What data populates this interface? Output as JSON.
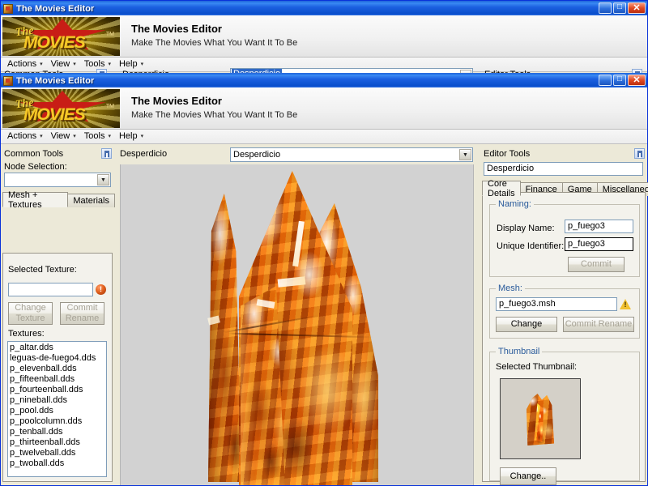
{
  "app": {
    "window_title": "The Movies Editor",
    "banner_title": "The Movies Editor",
    "banner_subtitle": "Make The Movies What You Want It To Be",
    "logo_the": "The",
    "logo_movies": "MOVIES",
    "logo_tm": "TM",
    "accent_title_blue": "#0a4ecb",
    "panel_face": "#ece9d8",
    "viewport_bg": "#d2d2d2"
  },
  "titlebar_buttons": {
    "minimize": "_",
    "maximize": "□",
    "close": "✕"
  },
  "menu": {
    "items": [
      {
        "label": "Actions",
        "arrow": "▾"
      },
      {
        "label": "View",
        "arrow": "▾"
      },
      {
        "label": "Tools",
        "arrow": "▾"
      },
      {
        "label": "Help",
        "arrow": "▾"
      }
    ]
  },
  "background_window": {
    "common_tools_label": "Common Tools",
    "node_label": "Desperdicio",
    "combo_value": "Desperdicio",
    "editor_tools_label": "Editor Tools"
  },
  "left_panel": {
    "header": "Common Tools",
    "node_selection_label": "Node Selection:",
    "node_selection_value": "",
    "tabs": [
      {
        "label": "Mesh + Textures",
        "active": true
      },
      {
        "label": "Materials",
        "active": false
      }
    ],
    "selected_texture_label": "Selected Texture:",
    "selected_texture_value": "",
    "change_texture_button": "Change\nTexture",
    "change_texture_line1": "Change",
    "change_texture_line2": "Texture",
    "commit_rename_line1": "Commit",
    "commit_rename_line2": "Rename",
    "textures_label": "Textures:",
    "textures": [
      "p_altar.dds",
      "leguas-de-fuego4.dds",
      "p_elevenball.dds",
      "p_fifteenball.dds",
      "p_fourteenball.dds",
      "p_nineball.dds",
      "p_pool.dds",
      "p_poolcolumn.dds",
      "p_tenball.dds",
      "p_thirteenball.dds",
      "p_twelveball.dds",
      "p_twoball.dds"
    ]
  },
  "center": {
    "node_label": "Desperdicio",
    "combo_value": "Desperdicio",
    "combo_arrow": "▼"
  },
  "right_panel": {
    "header": "Editor Tools",
    "object_name": "Desperdicio",
    "tabs": [
      {
        "label": "Core Details",
        "active": true
      },
      {
        "label": "Finance",
        "active": false
      },
      {
        "label": "Game",
        "active": false
      },
      {
        "label": "Miscellaneous",
        "active": false
      }
    ],
    "naming": {
      "group_title": "Naming:",
      "display_name_label": "Display Name:",
      "display_name_value": "p_fuego3",
      "unique_identifier_label": "Unique Identifier:",
      "unique_identifier_value": "p_fuego3",
      "commit_button": "Commit"
    },
    "mesh": {
      "group_title": "Mesh:",
      "value": "p_fuego3.msh",
      "warning_icon": "warning-icon",
      "change_button": "Change",
      "commit_rename_button": "Commit Rename"
    },
    "thumbnail": {
      "group_title": "Thumbnail",
      "selected_label": "Selected Thumbnail:",
      "change_button": "Change.."
    }
  }
}
